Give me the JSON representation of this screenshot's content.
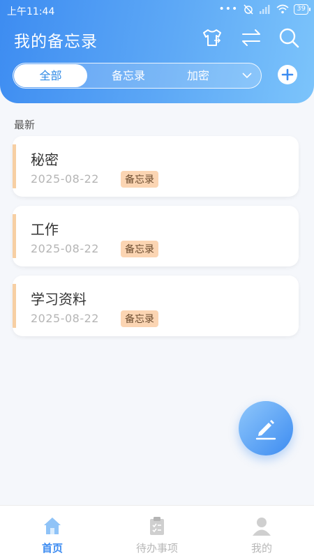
{
  "status_bar": {
    "time": "上午11:44",
    "battery": "39"
  },
  "header": {
    "title": "我的备忘录"
  },
  "tabs": [
    {
      "label": "全部",
      "active": true
    },
    {
      "label": "备忘录",
      "active": false
    },
    {
      "label": "加密",
      "active": false
    }
  ],
  "section": {
    "label": "最新"
  },
  "notes": [
    {
      "title": "秘密",
      "date": "2025-08-22",
      "tag": "备忘录"
    },
    {
      "title": "工作",
      "date": "2025-08-22",
      "tag": "备忘录"
    },
    {
      "title": "学习资料",
      "date": "2025-08-22",
      "tag": "备忘录"
    }
  ],
  "bottom_nav": [
    {
      "label": "首页",
      "icon": "home-icon",
      "active": true
    },
    {
      "label": "待办事项",
      "icon": "clipboard-icon",
      "active": false
    },
    {
      "label": "我的",
      "icon": "user-icon",
      "active": false
    }
  ],
  "colors": {
    "accent": "#3d8cf1",
    "tag_bg": "#fbd5b3",
    "card_bar": "#f7cfa3"
  }
}
